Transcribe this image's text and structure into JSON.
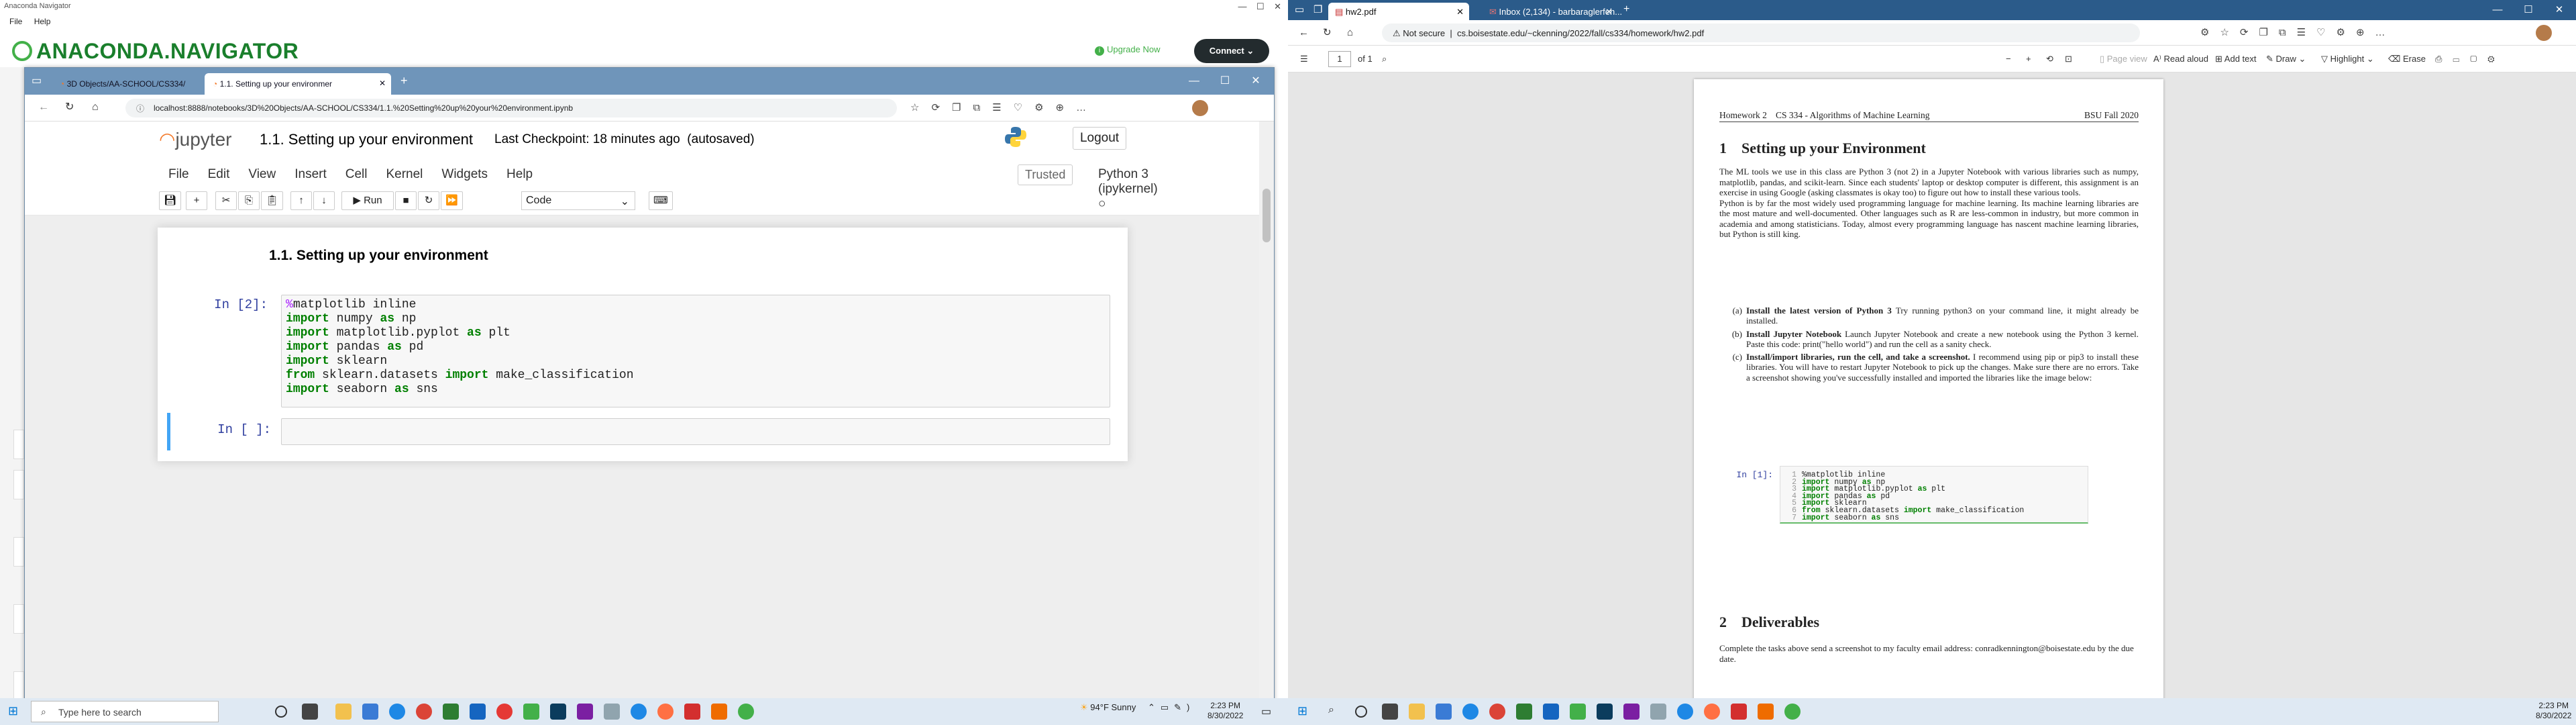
{
  "left": {
    "navigator": {
      "title": "Anaconda Navigator",
      "menu": [
        "File",
        "Help"
      ],
      "logo": "ANACONDA.NAVIGATOR",
      "upgrade": "Upgrade Now",
      "connect": "Connect"
    },
    "edge": {
      "tabs": [
        {
          "label": "3D Objects/AA-SCHOOL/CS334/"
        },
        {
          "label": "1.1. Setting up your environmer"
        }
      ],
      "url": "localhost:8888/notebooks/3D%20Objects/AA-SCHOOL/CS334/1.1.%20Setting%20up%20your%20environment.ipynb"
    },
    "jupyter": {
      "logo": "jupyter",
      "notebook_title": "1.1. Setting up your environment",
      "checkpoint": "Last Checkpoint: 18 minutes ago",
      "autosaved": "(autosaved)",
      "logout": "Logout",
      "menu": [
        "File",
        "Edit",
        "View",
        "Insert",
        "Cell",
        "Kernel",
        "Widgets",
        "Help"
      ],
      "trusted": "Trusted",
      "kernel": "Python 3 (ipykernel)",
      "run_label": "Run",
      "cell_type": "Code",
      "heading": "1.1. Setting up your environment",
      "cells": [
        {
          "prompt": "In [2]:",
          "lines": [
            [
              {
                "t": "%",
                "c": "mg"
              },
              {
                "t": "matplotlib inline",
                "c": ""
              }
            ],
            [
              {
                "t": "import",
                "c": "kw"
              },
              {
                "t": " numpy ",
                "c": ""
              },
              {
                "t": "as",
                "c": "kw"
              },
              {
                "t": " np",
                "c": ""
              }
            ],
            [
              {
                "t": "import",
                "c": "kw"
              },
              {
                "t": " matplotlib.pyplot ",
                "c": ""
              },
              {
                "t": "as",
                "c": "kw"
              },
              {
                "t": " plt",
                "c": ""
              }
            ],
            [
              {
                "t": "import",
                "c": "kw"
              },
              {
                "t": " pandas ",
                "c": ""
              },
              {
                "t": "as",
                "c": "kw"
              },
              {
                "t": " pd",
                "c": ""
              }
            ],
            [
              {
                "t": "import",
                "c": "kw"
              },
              {
                "t": " sklearn",
                "c": ""
              }
            ],
            [
              {
                "t": "from",
                "c": "kw"
              },
              {
                "t": " sklearn.datasets ",
                "c": ""
              },
              {
                "t": "import",
                "c": "kw"
              },
              {
                "t": " make_classification",
                "c": ""
              }
            ],
            [
              {
                "t": "import",
                "c": "kw"
              },
              {
                "t": " seaborn ",
                "c": ""
              },
              {
                "t": "as",
                "c": "kw"
              },
              {
                "t": " sns",
                "c": ""
              }
            ]
          ]
        },
        {
          "prompt": "In [ ]:",
          "lines": []
        }
      ]
    },
    "taskbar": {
      "search_placeholder": "Type here to search",
      "weather": "94°F  Sunny",
      "time": "2:23 PM",
      "date": "8/30/2022"
    }
  },
  "right": {
    "tabs": [
      {
        "label": "hw2.pdf"
      },
      {
        "label": "Inbox (2,134) - barbaraglerfeh..."
      }
    ],
    "security": "Not secure",
    "url": "cs.boisestate.edu/~ckenning/2022/fall/cs334/homework/hw2.pdf",
    "pdf_toolbar": {
      "page": "1",
      "of": "of 1",
      "page_view": "Page view",
      "read_aloud": "Read aloud",
      "add_text": "Add text",
      "draw": "Draw",
      "highlight": "Highlight",
      "erase": "Erase"
    },
    "pdf": {
      "header_left": "Homework 2",
      "header_mid": "CS 334 - Algorithms of Machine Learning",
      "header_right": "BSU Fall 2020",
      "s1_num": "1",
      "s1_title": "Setting up your Environment",
      "p1": "The ML tools we use in this class are Python 3 (not 2) in a Jupyter Notebook with various libraries such as numpy, matplotlib, pandas, and scikit-learn. Since each students' laptop or desktop computer is different, this assignment is an exercise in using Google (asking classmates is okay too) to figure out how to install these various tools.",
      "p2": "Python is by far the most widely used programming language for machine learning. Its machine learning libraries are the most mature and well-documented. Other languages such as R are less-common in industry, but more common in academia and among statisticians. Today, almost every programming language has nascent machine learning libraries, but Python is still king.",
      "items": [
        {
          "label": "(a)",
          "title": "Install the latest version of Python 3",
          "text": " Try running python3 on your command line, it might already be installed."
        },
        {
          "label": "(b)",
          "title": "Install Jupyter Notebook",
          "text": " Launch Jupyter Notebook and create a new notebook using the Python 3 kernel. Paste this code: print(\"hello world\") and run the cell as a sanity check."
        },
        {
          "label": "(c)",
          "title": "Install/import libraries, run the cell, and take a screenshot.",
          "text": " I recommend using pip or pip3 to install these libraries. You will have to restart Jupyter Notebook to pick up the changes. Make sure there are no errors. Take a screenshot showing you've successfully installed and imported the libraries like the image below:"
        }
      ],
      "code_prompt": "In [1]:",
      "code_lines": [
        "%matplotlib inline",
        "import numpy as np",
        "import matplotlib.pyplot as plt",
        "import pandas as pd",
        "import sklearn",
        "from sklearn.datasets import make_classification",
        "import seaborn as sns"
      ],
      "s2_num": "2",
      "s2_title": "Deliverables",
      "s2_text": "Complete the tasks above send a screenshot to my faculty email address: conradkennington@boisestate.edu by the due date."
    },
    "taskbar": {
      "time": "2:23 PM",
      "date": "8/30/2022"
    }
  }
}
